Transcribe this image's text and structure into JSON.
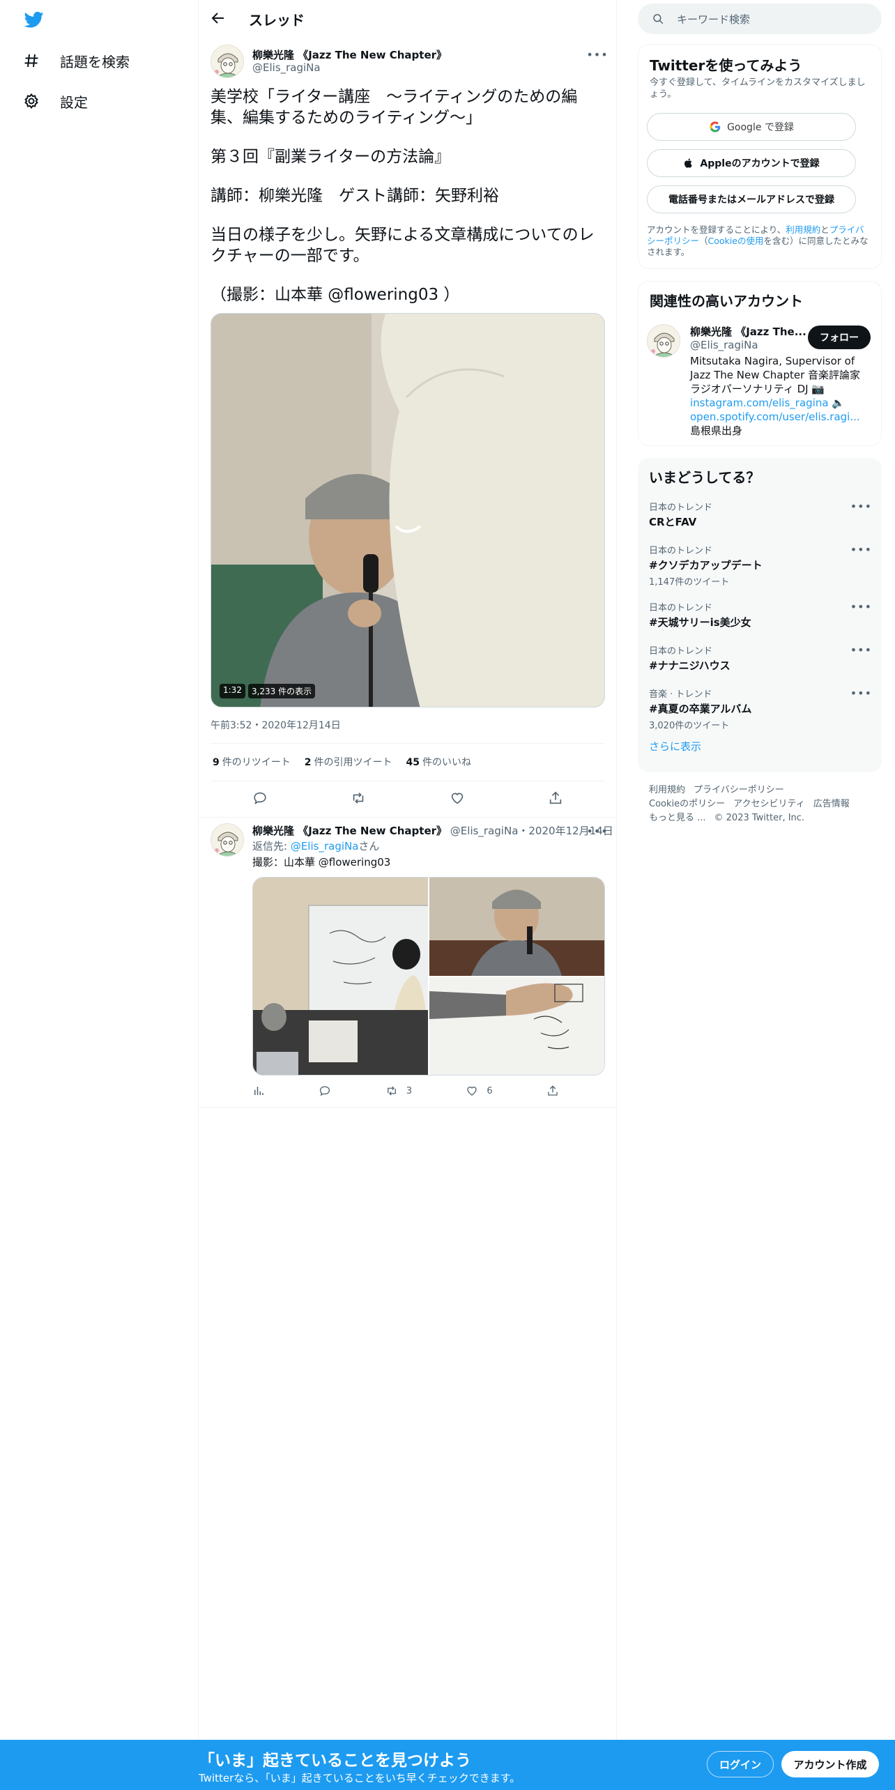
{
  "nav": {
    "explore_label": "話題を検索",
    "settings_label": "設定"
  },
  "header": {
    "title": "スレッド"
  },
  "tweet": {
    "author_name": "柳樂光隆 《Jazz The New Chapter》",
    "author_handle": "@Elis_ragiNa",
    "paragraphs": [
      "美学校「ライター講座　〜ライティングのための編集、編集するためのライティング〜」",
      "第３回『副業ライターの方法論』",
      "講師：柳樂光隆　ゲスト講師：矢野利裕",
      "当日の様子を少し。矢野による文章構成についてのレクチャーの一部です。",
      "（撮影：山本華 @flowering03 ）"
    ],
    "video_duration": "1:32",
    "video_views": "3,233 件の表示",
    "timestamp": "午前3:52・2020年12月14日",
    "stats": [
      {
        "count": "9",
        "label": "件のリツイート"
      },
      {
        "count": "2",
        "label": "件の引用ツイート"
      },
      {
        "count": "45",
        "label": "件のいいね"
      }
    ]
  },
  "reply": {
    "author_name": "柳樂光隆 《Jazz The New Chapter》",
    "author_handle": "@Elis_ragiNa",
    "date": "・2020年12月14日",
    "reply_prefix": "返信先: ",
    "reply_mention": "@Elis_ragiNa",
    "reply_suffix": "さん",
    "text": "撮影：山本華 @flowering03",
    "retweets": "3",
    "likes": "6"
  },
  "search": {
    "placeholder": "キーワード検索"
  },
  "signup": {
    "title": "Twitterを使ってみよう",
    "subtitle": "今すぐ登録して、タイムラインをカスタマイズしましょう。",
    "google": "Google で登録",
    "apple": "Appleのアカウントで登録",
    "phone": "電話番号またはメールアドレスで登録",
    "legal_1": "アカウントを登録することにより、",
    "legal_terms": "利用規約",
    "legal_2": "と",
    "legal_privacy": "プライバシーポリシー",
    "legal_3": "（",
    "legal_cookie": "Cookieの使用",
    "legal_4": "を含む）に同意したとみなされます。"
  },
  "related": {
    "title": "関連性の高いアカウント",
    "name": "柳樂光隆 《Jazz The...",
    "handle": "@Elis_ragiNa",
    "follow": "フォロー",
    "bio_1": "Mitsutaka Nagira, Supervisor of Jazz The New Chapter 音楽評論家 ラジオパーソナリティ DJ 📷 ",
    "bio_link1": "instagram.com/elis_ragina",
    "bio_2": " 🔈 ",
    "bio_link2": "open.spotify.com/user/elis.ragi...",
    "bio_3": " 島根県出身"
  },
  "trends": {
    "title": "いまどうしてる？",
    "items": [
      {
        "context": "日本のトレンド",
        "topic": "CRとFAV",
        "count": ""
      },
      {
        "context": "日本のトレンド",
        "topic": "#クソデカアップデート",
        "count": "1,147件のツイート"
      },
      {
        "context": "日本のトレンド",
        "topic": "#天城サリーis美少女",
        "count": ""
      },
      {
        "context": "日本のトレンド",
        "topic": "#ナナニジハウス",
        "count": ""
      },
      {
        "context": "音楽 · トレンド",
        "topic": "#真夏の卒業アルバム",
        "count": "3,020件のツイート"
      }
    ],
    "show_more": "さらに表示"
  },
  "footer": {
    "links": [
      "利用規約",
      "プライバシーポリシー",
      "Cookieのポリシー",
      "アクセシビリティ",
      "広告情報",
      "もっと見る ..."
    ],
    "copyright": "© 2023 Twitter, Inc."
  },
  "bottombar": {
    "title": "「いま」起きていることを見つけよう",
    "subtitle": "Twitterなら、「いま」起きていることをいち早くチェックできます。",
    "login": "ログイン",
    "signup": "アカウント作成"
  },
  "colors": {
    "accent": "#1d9bf0",
    "text": "#0f1419",
    "muted": "#536471"
  }
}
